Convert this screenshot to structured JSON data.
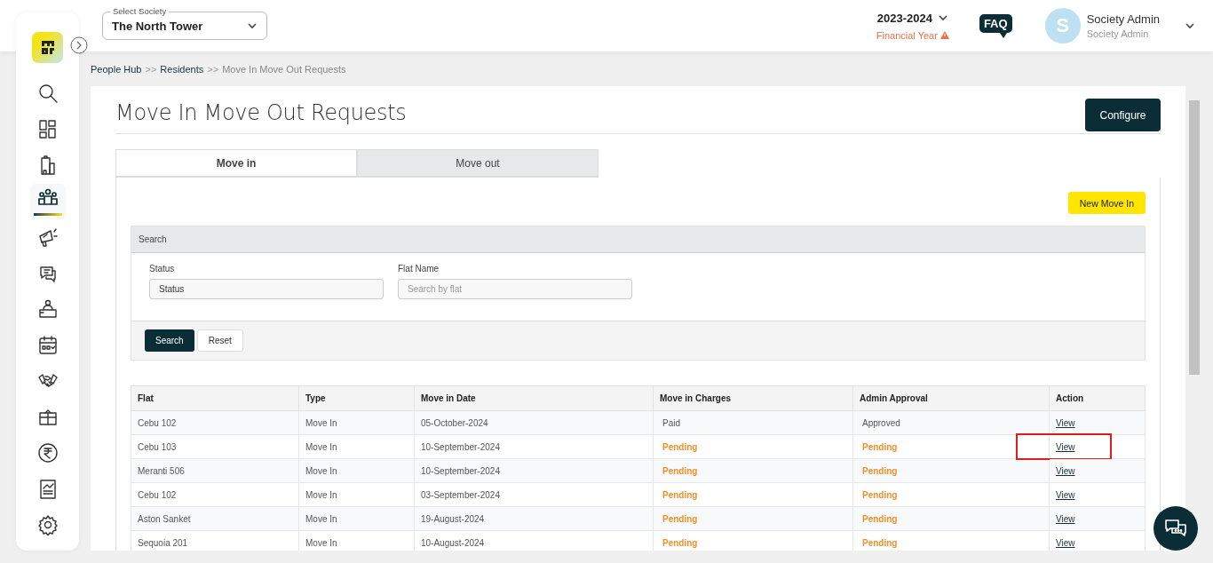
{
  "header": {
    "society_select": {
      "label": "Select Society",
      "value": "The North Tower"
    },
    "year": {
      "value": "2023-2024",
      "note": "Financial Year"
    },
    "faq": "FAQ",
    "user": {
      "initial": "S",
      "name": "Society Admin",
      "role": "Society Admin"
    }
  },
  "sidebar": {
    "items": [
      {
        "kind": "search",
        "selected": false
      },
      {
        "kind": "dashboard",
        "selected": false
      },
      {
        "kind": "building",
        "selected": false
      },
      {
        "kind": "people",
        "selected": true
      },
      {
        "kind": "megaphone",
        "selected": false
      },
      {
        "kind": "chat",
        "selected": false
      },
      {
        "kind": "desk",
        "selected": false
      },
      {
        "kind": "calendar",
        "selected": false
      },
      {
        "kind": "handshake",
        "selected": false
      },
      {
        "kind": "box",
        "selected": false
      },
      {
        "kind": "rupee",
        "selected": false
      },
      {
        "kind": "report",
        "selected": false
      },
      {
        "kind": "settings",
        "selected": false
      }
    ]
  },
  "breadcrumb": [
    {
      "label": "People Hub",
      "current": false
    },
    {
      "label": "Residents",
      "current": false
    },
    {
      "label": "Move In Move Out Requests",
      "current": true
    }
  ],
  "breadcrumb_separator": ">>",
  "page_title": "Move In Move Out Requests",
  "configure_button": "Configure",
  "tabs": [
    {
      "label": "Move in",
      "selected": true
    },
    {
      "label": "Move out",
      "selected": false
    }
  ],
  "new_button": "New Move In",
  "search_panel": {
    "title": "Search",
    "fields": [
      {
        "label": "Status",
        "value": "Status"
      },
      {
        "label": "Flat Name",
        "placeholder": "Search by flat"
      }
    ],
    "buttons": [
      {
        "label": "Search",
        "kind": "primary"
      },
      {
        "label": "Reset",
        "kind": "secondary"
      }
    ]
  },
  "table": {
    "columns": [
      "Flat",
      "Type",
      "Move in Date",
      "Move in Charges",
      "Admin Approval",
      "Action"
    ],
    "rows": [
      {
        "flat": "Cebu 102",
        "type": "Move In",
        "date": "05-October-2024",
        "charges": {
          "text": "Paid",
          "kind": "done"
        },
        "approval": {
          "text": "Approved",
          "kind": "done"
        },
        "action": "View",
        "highlighted": false
      },
      {
        "flat": "Cebu 103",
        "type": "Move In",
        "date": "10-September-2024",
        "charges": {
          "text": "Pending",
          "kind": "pending"
        },
        "approval": {
          "text": "Pending",
          "kind": "pending"
        },
        "action": "View",
        "highlighted": true
      },
      {
        "flat": "Meranti 506",
        "type": "Move In",
        "date": "10-September-2024",
        "charges": {
          "text": "Pending",
          "kind": "pending"
        },
        "approval": {
          "text": "Pending",
          "kind": "pending"
        },
        "action": "View",
        "highlighted": false
      },
      {
        "flat": "Cebu 102",
        "type": "Move In",
        "date": "03-September-2024",
        "charges": {
          "text": "Pending",
          "kind": "pending"
        },
        "approval": {
          "text": "Pending",
          "kind": "pending"
        },
        "action": "View",
        "highlighted": false
      },
      {
        "flat": "Aston Sanket",
        "type": "Move In",
        "date": "19-August-2024",
        "charges": {
          "text": "Pending",
          "kind": "pending"
        },
        "approval": {
          "text": "Pending",
          "kind": "pending"
        },
        "action": "View",
        "highlighted": false
      },
      {
        "flat": "Sequoia 201",
        "type": "Move In",
        "date": "10-August-2024",
        "charges": {
          "text": "Pending",
          "kind": "pending"
        },
        "approval": {
          "text": "Pending",
          "kind": "pending"
        },
        "action": "View",
        "highlighted": false
      }
    ]
  }
}
